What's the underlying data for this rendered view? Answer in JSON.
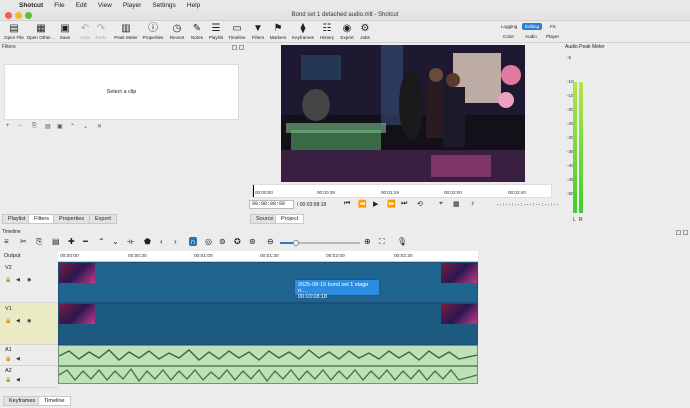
{
  "menubar": {
    "app": "Shotcut",
    "items": [
      "File",
      "Edit",
      "View",
      "Player",
      "Settings",
      "Help"
    ]
  },
  "window": {
    "title": "Bond set 1 detached audio.mlt - Shotcut"
  },
  "toolbar": {
    "items": [
      {
        "label": "Open File",
        "icon": "open-file-icon"
      },
      {
        "label": "Open Other…",
        "icon": "open-other-icon"
      },
      {
        "label": "Save",
        "icon": "save-icon"
      },
      {
        "label": "Undo",
        "icon": "undo-icon"
      },
      {
        "label": "Redo",
        "icon": "redo-icon"
      },
      {
        "label": "Peak Meter",
        "icon": "peak-meter-icon"
      },
      {
        "label": "Properties",
        "icon": "properties-icon"
      },
      {
        "label": "Recent",
        "icon": "recent-icon"
      },
      {
        "label": "Notes",
        "icon": "notes-icon"
      },
      {
        "label": "Playlist",
        "icon": "playlist-icon"
      },
      {
        "label": "Timeline",
        "icon": "timeline-icon"
      },
      {
        "label": "Filters",
        "icon": "filters-icon"
      },
      {
        "label": "Markers",
        "icon": "markers-icon"
      },
      {
        "label": "History",
        "icon": "history-icon"
      },
      {
        "label": "Keyframes",
        "icon": "keyframes-icon"
      },
      {
        "label": "Export",
        "icon": "export-icon"
      },
      {
        "label": "Jobs",
        "icon": "jobs-icon"
      }
    ],
    "layouts": {
      "logging": "Logging",
      "editing": "Editing",
      "fx": "FX",
      "color": "Color",
      "audio": "Audio",
      "player": "Player"
    }
  },
  "filters": {
    "title": "Filters",
    "empty": "Select a clip"
  },
  "left_tabs": [
    "Playlist",
    "Filters",
    "Properties",
    "Export"
  ],
  "player": {
    "ruler": [
      "00:00:00",
      "00:00:39",
      "00:01:19",
      "00:02:00",
      "00:02:40"
    ],
    "timecode": "00:00:00:00",
    "duration": "/ 00:03:08:18",
    "in_point": "--:--:--:--",
    "out_point": "--:--:--:--",
    "tabs": [
      "Source",
      "Project"
    ]
  },
  "meter": {
    "title": "Audio Peak Meter",
    "ticks": [
      "-5",
      "-10",
      "-15",
      "-20",
      "-25",
      "-30",
      "-35",
      "-40",
      "-45",
      "-50"
    ],
    "channels": [
      "L",
      "R"
    ]
  },
  "timeline": {
    "title": "Timeline",
    "ruler": [
      "00:00:00",
      "00:00:30",
      "00:01:00",
      "00:01:30",
      "00:02:00",
      "00:02:30"
    ],
    "output": "Output",
    "tracks": [
      "V2",
      "V1",
      "A1",
      "A2"
    ],
    "selected_clip": {
      "name": "2025-08-16 bond set 1 stage ri…",
      "duration": "00:03:08:18"
    }
  },
  "bottom_tabs": [
    "Keyframes",
    "Timeline"
  ],
  "colors": {
    "accent": "#2e7bd6",
    "video_clip": "#1f6590",
    "audio_clip": "#bfe0b9"
  }
}
